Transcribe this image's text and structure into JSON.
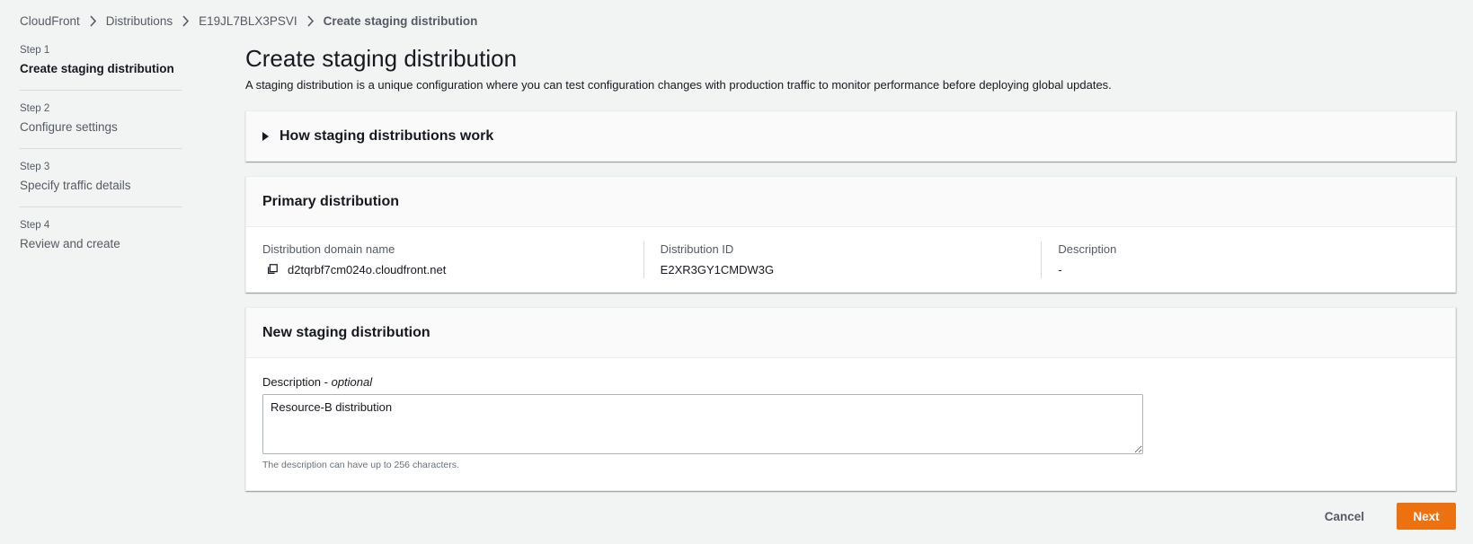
{
  "breadcrumb": [
    {
      "label": "CloudFront"
    },
    {
      "label": "Distributions"
    },
    {
      "label": "E19JL7BLX3PSVI"
    },
    {
      "label": "Create staging distribution"
    }
  ],
  "steps": [
    {
      "num": "Step 1",
      "label": "Create staging distribution"
    },
    {
      "num": "Step 2",
      "label": "Configure settings"
    },
    {
      "num": "Step 3",
      "label": "Specify traffic details"
    },
    {
      "num": "Step 4",
      "label": "Review and create"
    }
  ],
  "page": {
    "title": "Create staging distribution",
    "description": "A staging distribution is a unique configuration where you can test configuration changes with production traffic to monitor performance before deploying global updates."
  },
  "how_it_works": {
    "title": "How staging distributions work"
  },
  "primary": {
    "title": "Primary distribution",
    "domain_label": "Distribution domain name",
    "domain_value": "d2tqrbf7cm024o.cloudfront.net",
    "id_label": "Distribution ID",
    "id_value": "E2XR3GY1CMDW3G",
    "desc_label": "Description",
    "desc_value": "-"
  },
  "staging": {
    "title": "New staging distribution",
    "field_label": "Description",
    "field_label_sep": " - ",
    "field_optional": "optional",
    "field_value": "Resource-B distribution",
    "hint": "The description can have up to 256 characters."
  },
  "actions": {
    "cancel": "Cancel",
    "next": "Next"
  }
}
